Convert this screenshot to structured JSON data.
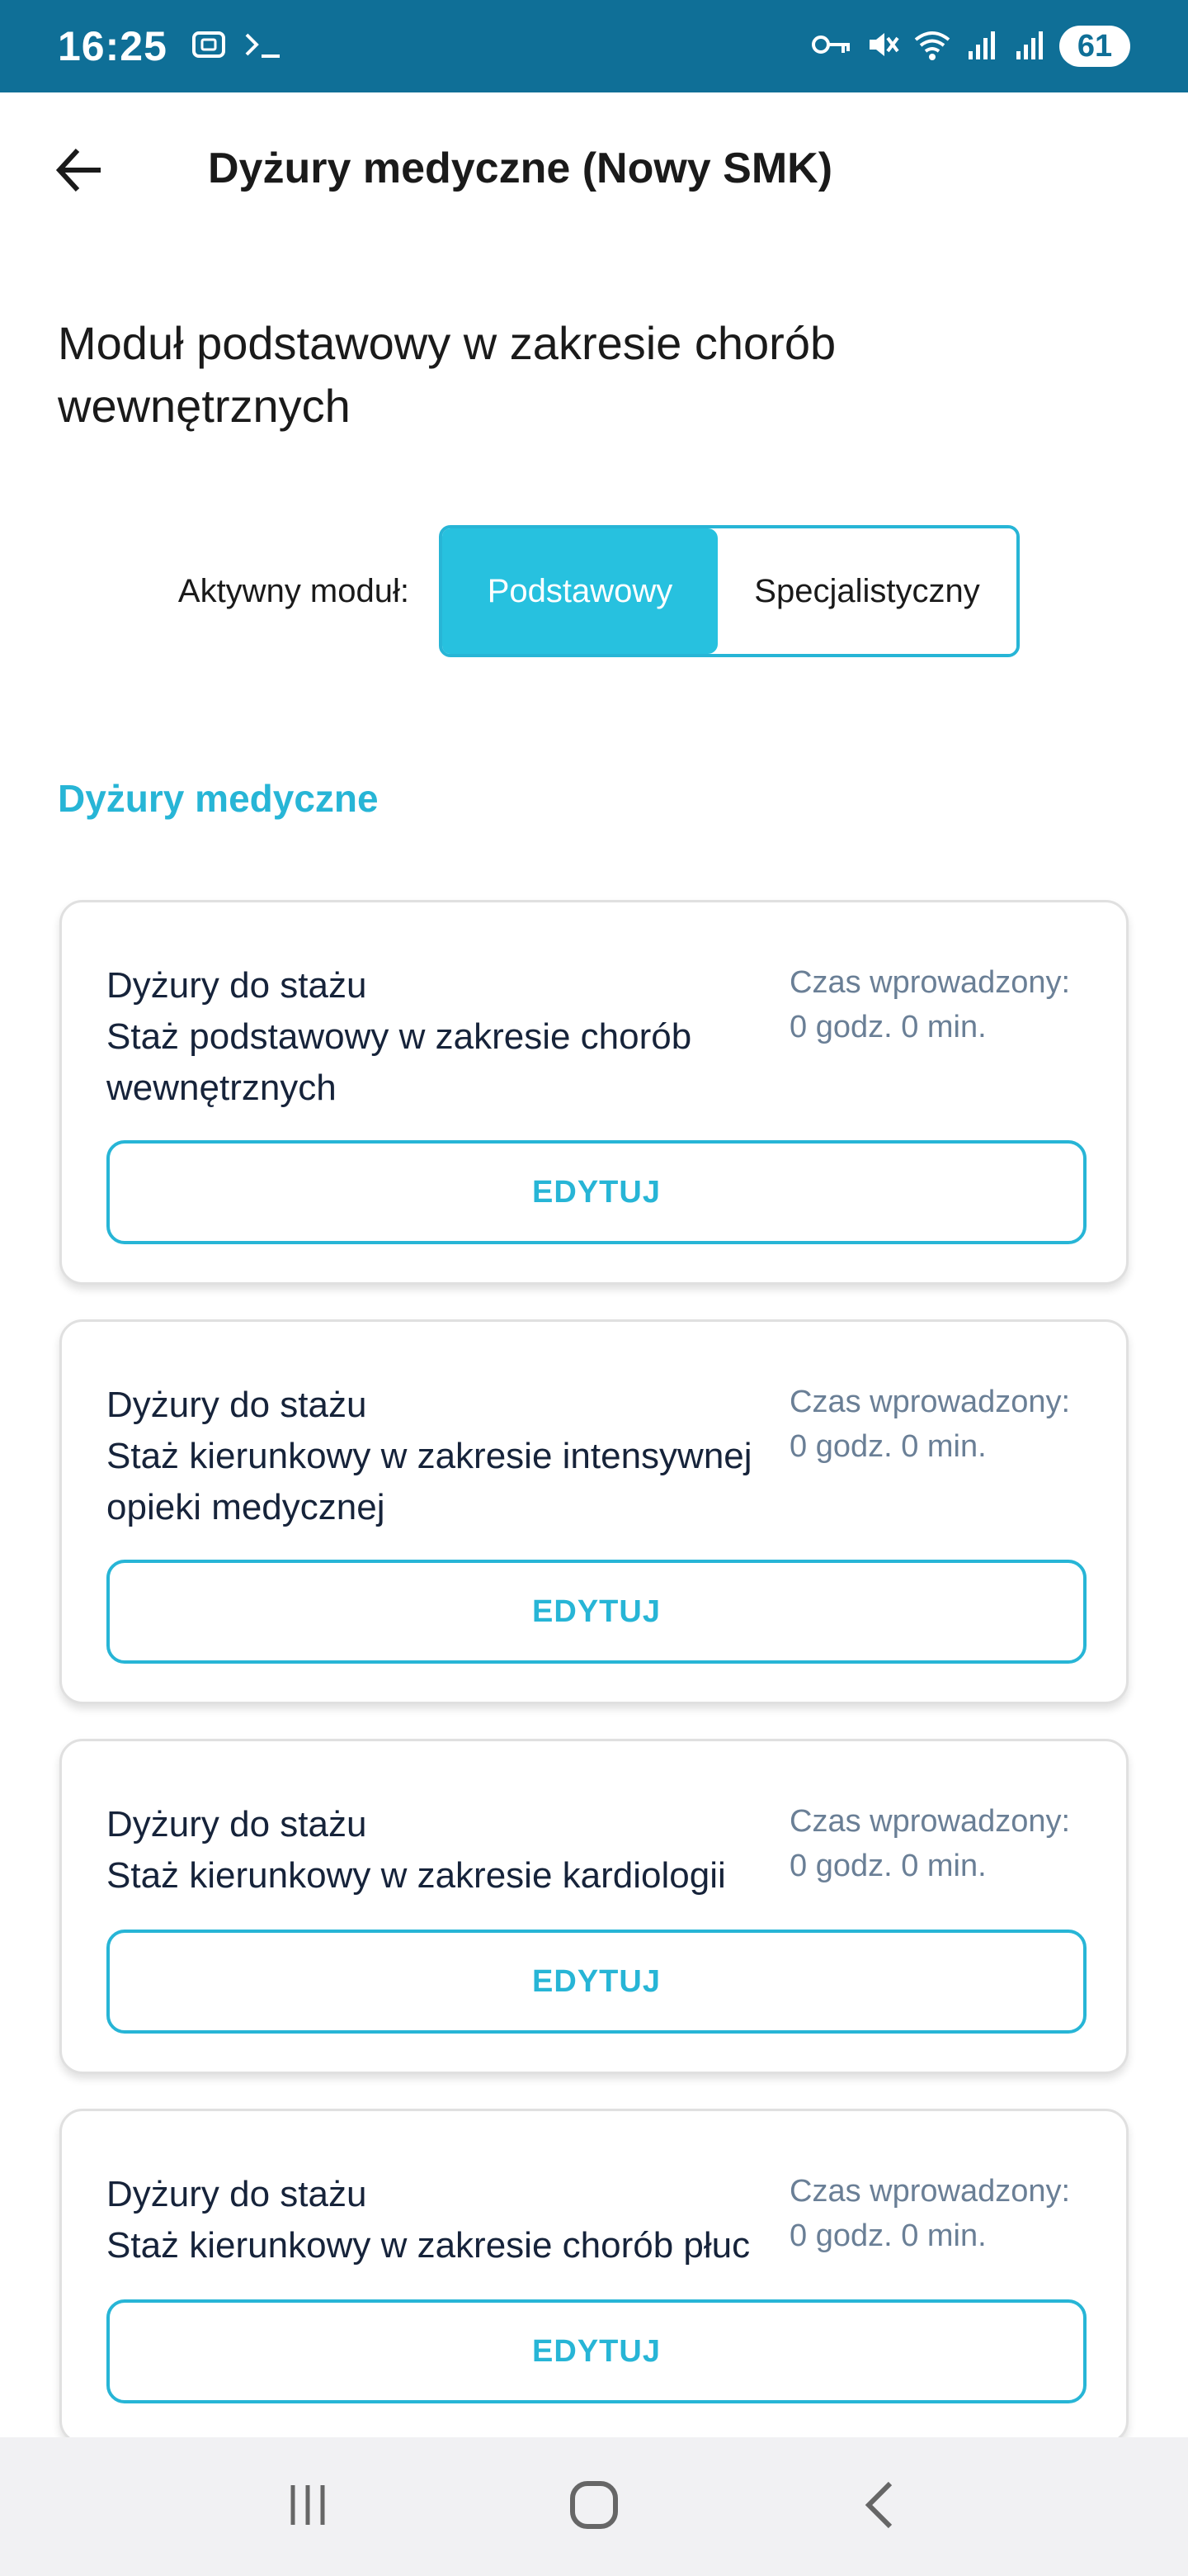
{
  "status_bar": {
    "time": "16:25",
    "battery": "61"
  },
  "app_bar": {
    "title": "Dyżury medyczne (Nowy SMK)"
  },
  "page": {
    "heading": "Moduł podstawowy w zakresie chorób wewnętrznych",
    "module_label": "Aktywny moduł:",
    "module_options": [
      "Podstawowy",
      "Specjalistyczny"
    ],
    "active_module": "Podstawowy",
    "section_title": "Dyżury medyczne"
  },
  "cards": [
    {
      "line1": "Dyżury do stażu",
      "line2": "Staż podstawowy w zakresie chorób wewnętrznych",
      "time_label": "Czas wprowadzony:",
      "time_value": "0 godz. 0 min.",
      "button": "EDYTUJ"
    },
    {
      "line1": "Dyżury do stażu",
      "line2": "Staż kierunkowy w zakresie intensywnej opieki medycznej",
      "time_label": "Czas wprowadzony:",
      "time_value": "0 godz. 0 min.",
      "button": "EDYTUJ"
    },
    {
      "line1": "Dyżury do stażu",
      "line2": "Staż kierunkowy w zakresie kardiologii",
      "time_label": "Czas wprowadzony:",
      "time_value": "0 godz. 0 min.",
      "button": "EDYTUJ"
    },
    {
      "line1": "Dyżury do stażu",
      "line2": "Staż kierunkowy w zakresie chorób płuc",
      "time_label": "Czas wprowadzony:",
      "time_value": "0 godz. 0 min.",
      "button": "EDYTUJ"
    }
  ],
  "icons": {
    "back": "arrow-left-icon",
    "status_left": [
      "screenshot-icon",
      "terminal-icon"
    ],
    "status_right": [
      "vpn-key-icon",
      "mute-icon",
      "wifi-icon",
      "signal-icon",
      "signal-icon"
    ],
    "nav": [
      "recents-icon",
      "home-icon",
      "back-nav-icon"
    ]
  },
  "colors": {
    "status_bar": "#0f6f97",
    "accent": "#27b5d6",
    "text_dark": "#1a1a1a",
    "text_muted": "#6a7f96"
  }
}
